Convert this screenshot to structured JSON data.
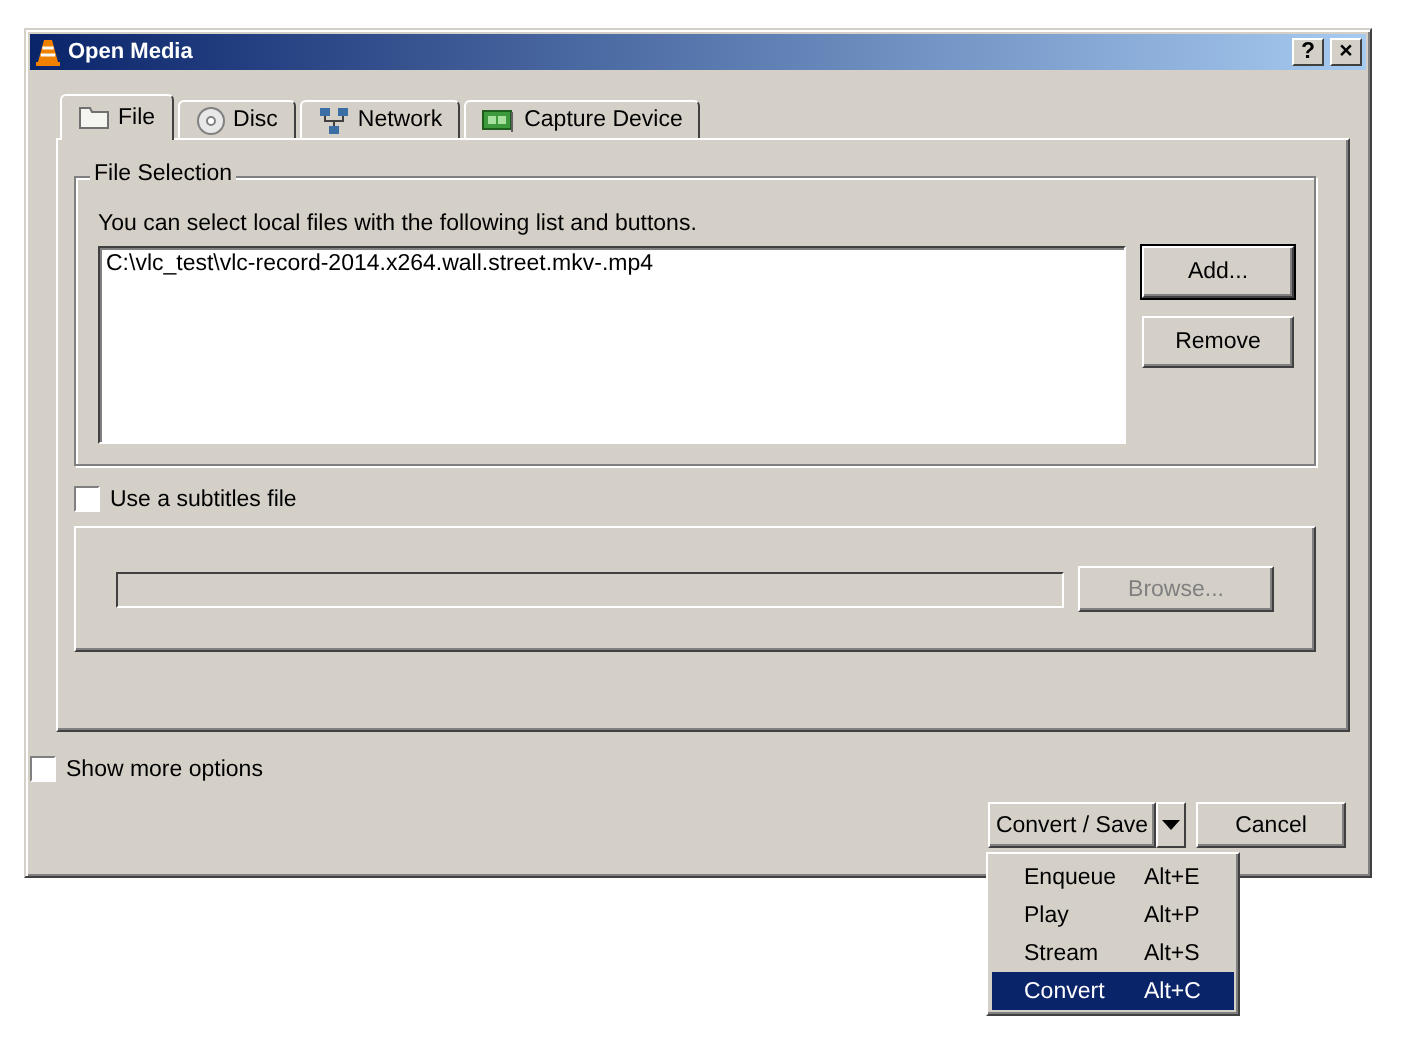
{
  "window": {
    "title": "Open Media",
    "title_buttons": [
      "?",
      "×"
    ]
  },
  "tabs": [
    {
      "label": "File",
      "kind": "folder",
      "selected": true
    },
    {
      "label": "Disc",
      "kind": "disc",
      "selected": false
    },
    {
      "label": "Network",
      "kind": "network",
      "selected": false
    },
    {
      "label": "Capture Device",
      "kind": "card",
      "selected": false
    }
  ],
  "file_selection": {
    "title": "File Selection",
    "hint": "You can select local files with the following list and buttons.",
    "files": [
      "C:\\vlc_test\\vlc-record-2014.x264.wall.street.mkv-.mp4"
    ],
    "buttons": [
      {
        "label": "Add...",
        "default": true
      },
      {
        "label": "Remove",
        "default": false
      }
    ]
  },
  "subtitles": {
    "label": "Use a subtitles file",
    "checked": false,
    "browse": {
      "label": "Browse...",
      "disabled": true
    }
  },
  "show_more": {
    "label": "Show more options",
    "checked": false
  },
  "buttons": {
    "primary": "Convert / Save",
    "cancel": "Cancel"
  },
  "menu": [
    {
      "label": "Enqueue",
      "shortcut": "Alt+E",
      "selected": false
    },
    {
      "label": "Play",
      "shortcut": "Alt+P",
      "selected": false
    },
    {
      "label": "Stream",
      "shortcut": "Alt+S",
      "selected": false
    },
    {
      "label": "Convert",
      "shortcut": "Alt+C",
      "selected": true
    }
  ]
}
